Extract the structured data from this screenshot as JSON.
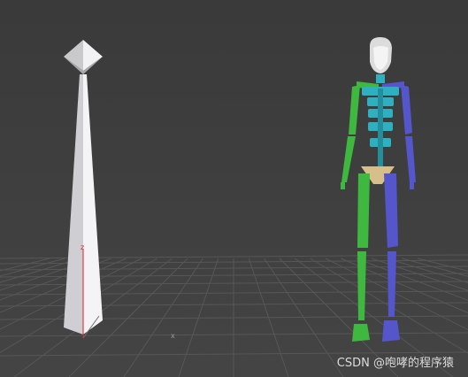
{
  "viewport": {
    "background_color": "#3c3c3c",
    "grid_color": "#575757"
  },
  "bone_object": {
    "color": "#e9e9ec",
    "axis_label_z": "z",
    "axis_z_color": "#e02020"
  },
  "grid_axis_label_x": "x",
  "biped": {
    "left_color": "#3fb83f",
    "right_color": "#5555cc",
    "spine_color": "#2fb0c0",
    "pelvis_color": "#d6bf8a",
    "head_color": "#dcdcdc"
  },
  "watermark": {
    "text": "CSDN @咆哮的程序猿"
  }
}
